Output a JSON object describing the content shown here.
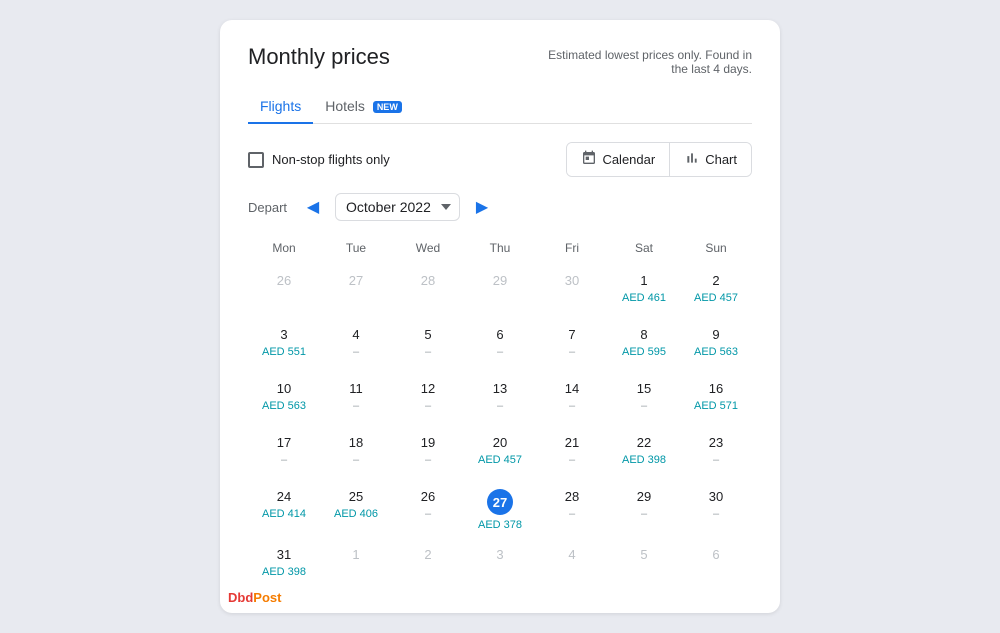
{
  "page": {
    "title": "Monthly prices",
    "subtitle": "Estimated lowest prices only. Found in the last 4 days."
  },
  "tabs": [
    {
      "label": "Flights",
      "active": true,
      "badge": null
    },
    {
      "label": "Hotels",
      "active": false,
      "badge": "NEW"
    }
  ],
  "controls": {
    "checkbox_label": "Non-stop flights only",
    "calendar_btn": "Calendar",
    "chart_btn": "Chart"
  },
  "depart": {
    "label": "Depart",
    "month": "October 2022"
  },
  "calendar": {
    "day_headers": [
      "Mon",
      "Tue",
      "Wed",
      "Thu",
      "Fri",
      "Sat",
      "Sun"
    ],
    "weeks": [
      [
        {
          "date": "26",
          "other": true,
          "price": null,
          "selected": false
        },
        {
          "date": "27",
          "other": true,
          "price": null,
          "selected": false
        },
        {
          "date": "28",
          "other": true,
          "price": null,
          "selected": false
        },
        {
          "date": "29",
          "other": true,
          "price": null,
          "selected": false
        },
        {
          "date": "30",
          "other": true,
          "price": null,
          "selected": false
        },
        {
          "date": "1",
          "other": false,
          "price": "AED 461",
          "selected": false
        },
        {
          "date": "2",
          "other": false,
          "price": "AED 457",
          "selected": false
        }
      ],
      [
        {
          "date": "3",
          "other": false,
          "price": "AED 551",
          "selected": false
        },
        {
          "date": "4",
          "other": false,
          "price": null,
          "selected": false
        },
        {
          "date": "5",
          "other": false,
          "price": null,
          "selected": false
        },
        {
          "date": "6",
          "other": false,
          "price": null,
          "selected": false
        },
        {
          "date": "7",
          "other": false,
          "price": null,
          "selected": false
        },
        {
          "date": "8",
          "other": false,
          "price": "AED 595",
          "selected": false
        },
        {
          "date": "9",
          "other": false,
          "price": "AED 563",
          "selected": false
        }
      ],
      [
        {
          "date": "10",
          "other": false,
          "price": "AED 563",
          "selected": false
        },
        {
          "date": "11",
          "other": false,
          "price": null,
          "selected": false
        },
        {
          "date": "12",
          "other": false,
          "price": null,
          "selected": false
        },
        {
          "date": "13",
          "other": false,
          "price": null,
          "selected": false
        },
        {
          "date": "14",
          "other": false,
          "price": null,
          "selected": false
        },
        {
          "date": "15",
          "other": false,
          "price": null,
          "selected": false
        },
        {
          "date": "16",
          "other": false,
          "price": "AED 571",
          "selected": false
        }
      ],
      [
        {
          "date": "17",
          "other": false,
          "price": null,
          "selected": false
        },
        {
          "date": "18",
          "other": false,
          "price": null,
          "selected": false
        },
        {
          "date": "19",
          "other": false,
          "price": null,
          "selected": false
        },
        {
          "date": "20",
          "other": false,
          "price": "AED 457",
          "selected": false
        },
        {
          "date": "21",
          "other": false,
          "price": null,
          "selected": false
        },
        {
          "date": "22",
          "other": false,
          "price": "AED 398",
          "selected": false
        },
        {
          "date": "23",
          "other": false,
          "price": null,
          "selected": false
        }
      ],
      [
        {
          "date": "24",
          "other": false,
          "price": "AED 414",
          "selected": false
        },
        {
          "date": "25",
          "other": false,
          "price": "AED 406",
          "selected": false
        },
        {
          "date": "26",
          "other": false,
          "price": null,
          "selected": false
        },
        {
          "date": "27",
          "other": false,
          "price": "AED 378",
          "selected": true
        },
        {
          "date": "28",
          "other": false,
          "price": null,
          "selected": false
        },
        {
          "date": "29",
          "other": false,
          "price": null,
          "selected": false
        },
        {
          "date": "30",
          "other": false,
          "price": null,
          "selected": false
        }
      ],
      [
        {
          "date": "31",
          "other": false,
          "price": "AED 398",
          "selected": false
        },
        {
          "date": "1",
          "other": true,
          "price": null,
          "selected": false
        },
        {
          "date": "2",
          "other": true,
          "price": null,
          "selected": false
        },
        {
          "date": "3",
          "other": true,
          "price": null,
          "selected": false
        },
        {
          "date": "4",
          "other": true,
          "price": null,
          "selected": false
        },
        {
          "date": "5",
          "other": true,
          "price": null,
          "selected": false
        },
        {
          "date": "6",
          "other": true,
          "price": null,
          "selected": false
        }
      ]
    ]
  },
  "watermark": {
    "part1": "Dbd",
    "part2": "Post"
  }
}
